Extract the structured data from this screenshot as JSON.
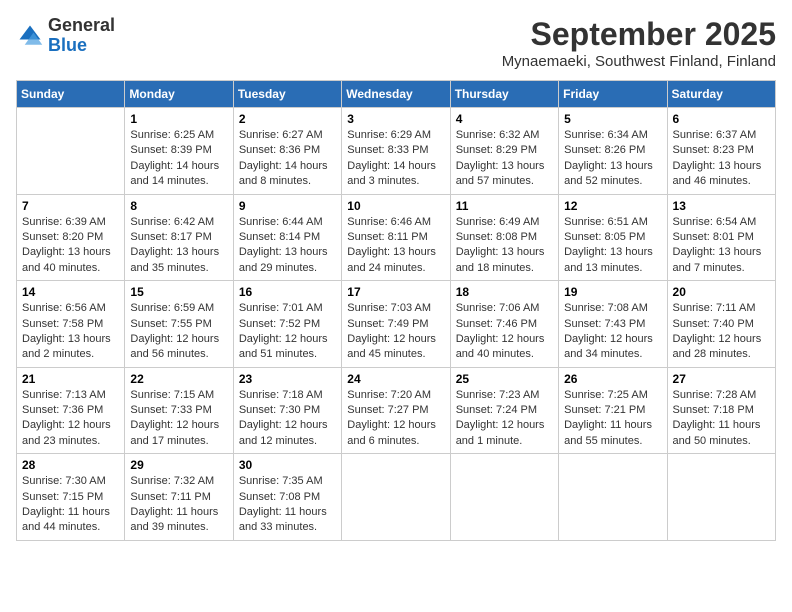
{
  "header": {
    "logo_general": "General",
    "logo_blue": "Blue",
    "month_title": "September 2025",
    "location": "Mynaemaeki, Southwest Finland, Finland"
  },
  "days_of_week": [
    "Sunday",
    "Monday",
    "Tuesday",
    "Wednesday",
    "Thursday",
    "Friday",
    "Saturday"
  ],
  "weeks": [
    [
      {
        "day": "",
        "info": ""
      },
      {
        "day": "1",
        "info": "Sunrise: 6:25 AM\nSunset: 8:39 PM\nDaylight: 14 hours\nand 14 minutes."
      },
      {
        "day": "2",
        "info": "Sunrise: 6:27 AM\nSunset: 8:36 PM\nDaylight: 14 hours\nand 8 minutes."
      },
      {
        "day": "3",
        "info": "Sunrise: 6:29 AM\nSunset: 8:33 PM\nDaylight: 14 hours\nand 3 minutes."
      },
      {
        "day": "4",
        "info": "Sunrise: 6:32 AM\nSunset: 8:29 PM\nDaylight: 13 hours\nand 57 minutes."
      },
      {
        "day": "5",
        "info": "Sunrise: 6:34 AM\nSunset: 8:26 PM\nDaylight: 13 hours\nand 52 minutes."
      },
      {
        "day": "6",
        "info": "Sunrise: 6:37 AM\nSunset: 8:23 PM\nDaylight: 13 hours\nand 46 minutes."
      }
    ],
    [
      {
        "day": "7",
        "info": "Sunrise: 6:39 AM\nSunset: 8:20 PM\nDaylight: 13 hours\nand 40 minutes."
      },
      {
        "day": "8",
        "info": "Sunrise: 6:42 AM\nSunset: 8:17 PM\nDaylight: 13 hours\nand 35 minutes."
      },
      {
        "day": "9",
        "info": "Sunrise: 6:44 AM\nSunset: 8:14 PM\nDaylight: 13 hours\nand 29 minutes."
      },
      {
        "day": "10",
        "info": "Sunrise: 6:46 AM\nSunset: 8:11 PM\nDaylight: 13 hours\nand 24 minutes."
      },
      {
        "day": "11",
        "info": "Sunrise: 6:49 AM\nSunset: 8:08 PM\nDaylight: 13 hours\nand 18 minutes."
      },
      {
        "day": "12",
        "info": "Sunrise: 6:51 AM\nSunset: 8:05 PM\nDaylight: 13 hours\nand 13 minutes."
      },
      {
        "day": "13",
        "info": "Sunrise: 6:54 AM\nSunset: 8:01 PM\nDaylight: 13 hours\nand 7 minutes."
      }
    ],
    [
      {
        "day": "14",
        "info": "Sunrise: 6:56 AM\nSunset: 7:58 PM\nDaylight: 13 hours\nand 2 minutes."
      },
      {
        "day": "15",
        "info": "Sunrise: 6:59 AM\nSunset: 7:55 PM\nDaylight: 12 hours\nand 56 minutes."
      },
      {
        "day": "16",
        "info": "Sunrise: 7:01 AM\nSunset: 7:52 PM\nDaylight: 12 hours\nand 51 minutes."
      },
      {
        "day": "17",
        "info": "Sunrise: 7:03 AM\nSunset: 7:49 PM\nDaylight: 12 hours\nand 45 minutes."
      },
      {
        "day": "18",
        "info": "Sunrise: 7:06 AM\nSunset: 7:46 PM\nDaylight: 12 hours\nand 40 minutes."
      },
      {
        "day": "19",
        "info": "Sunrise: 7:08 AM\nSunset: 7:43 PM\nDaylight: 12 hours\nand 34 minutes."
      },
      {
        "day": "20",
        "info": "Sunrise: 7:11 AM\nSunset: 7:40 PM\nDaylight: 12 hours\nand 28 minutes."
      }
    ],
    [
      {
        "day": "21",
        "info": "Sunrise: 7:13 AM\nSunset: 7:36 PM\nDaylight: 12 hours\nand 23 minutes."
      },
      {
        "day": "22",
        "info": "Sunrise: 7:15 AM\nSunset: 7:33 PM\nDaylight: 12 hours\nand 17 minutes."
      },
      {
        "day": "23",
        "info": "Sunrise: 7:18 AM\nSunset: 7:30 PM\nDaylight: 12 hours\nand 12 minutes."
      },
      {
        "day": "24",
        "info": "Sunrise: 7:20 AM\nSunset: 7:27 PM\nDaylight: 12 hours\nand 6 minutes."
      },
      {
        "day": "25",
        "info": "Sunrise: 7:23 AM\nSunset: 7:24 PM\nDaylight: 12 hours\nand 1 minute."
      },
      {
        "day": "26",
        "info": "Sunrise: 7:25 AM\nSunset: 7:21 PM\nDaylight: 11 hours\nand 55 minutes."
      },
      {
        "day": "27",
        "info": "Sunrise: 7:28 AM\nSunset: 7:18 PM\nDaylight: 11 hours\nand 50 minutes."
      }
    ],
    [
      {
        "day": "28",
        "info": "Sunrise: 7:30 AM\nSunset: 7:15 PM\nDaylight: 11 hours\nand 44 minutes."
      },
      {
        "day": "29",
        "info": "Sunrise: 7:32 AM\nSunset: 7:11 PM\nDaylight: 11 hours\nand 39 minutes."
      },
      {
        "day": "30",
        "info": "Sunrise: 7:35 AM\nSunset: 7:08 PM\nDaylight: 11 hours\nand 33 minutes."
      },
      {
        "day": "",
        "info": ""
      },
      {
        "day": "",
        "info": ""
      },
      {
        "day": "",
        "info": ""
      },
      {
        "day": "",
        "info": ""
      }
    ]
  ]
}
